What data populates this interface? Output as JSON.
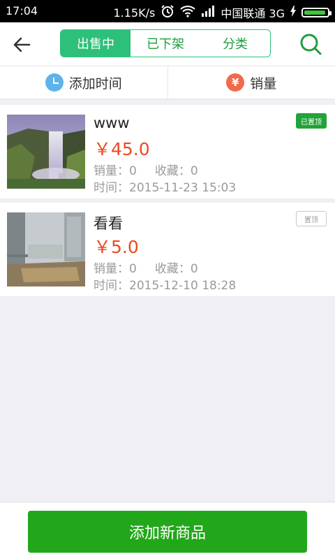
{
  "status_bar": {
    "time": "17:04",
    "speed": "1.15K/s",
    "carrier": "中国联通 3G",
    "icons": [
      "alarm-icon",
      "wifi-icon",
      "signal-icon",
      "charging-icon",
      "battery-icon"
    ]
  },
  "header": {
    "tabs": [
      {
        "label": "出售中",
        "active": true
      },
      {
        "label": "已下架",
        "active": false
      },
      {
        "label": "分类",
        "active": false
      }
    ],
    "accent_color": "#2cc07a"
  },
  "sort_bar": {
    "by_time_label": "添加时间",
    "by_sales_label": "销量",
    "sales_icon_glyph": "¥"
  },
  "items": [
    {
      "title": "www",
      "price": "￥45.0",
      "sales": "销量：0",
      "favorites": "收藏：0",
      "time": "时间：2015-11-23 15:03",
      "pin_label": "已置顶",
      "pinned": true
    },
    {
      "title": "看看",
      "price": "￥5.0",
      "sales": "销量：0",
      "favorites": "收藏：0",
      "time": "时间：2015-12-10 18:28",
      "pin_label": "置顶",
      "pinned": false
    }
  ],
  "bottom": {
    "add_button_label": "添加新商品",
    "button_color": "#22a71a"
  }
}
